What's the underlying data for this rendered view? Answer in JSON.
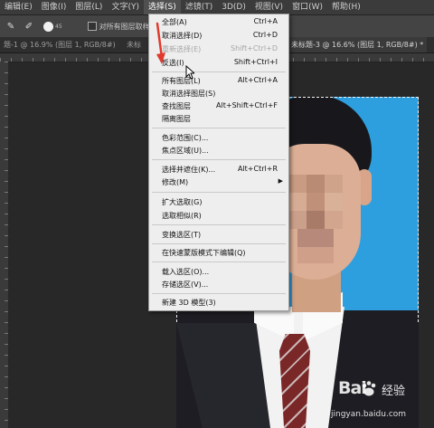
{
  "menubar": {
    "items": [
      {
        "label": "编辑(E)"
      },
      {
        "label": "图像(I)"
      },
      {
        "label": "图层(L)"
      },
      {
        "label": "文字(Y)"
      },
      {
        "label": "选择(S)",
        "active": true
      },
      {
        "label": "滤镜(T)"
      },
      {
        "label": "3D(D)"
      },
      {
        "label": "视图(V)"
      },
      {
        "label": "窗口(W)"
      },
      {
        "label": "帮助(H)"
      }
    ]
  },
  "options": {
    "brush_size": "45",
    "sample_all_layers_label": "对所有图层取样"
  },
  "tabs": {
    "left": "题-1 @ 16.9% (图层 1, RGB/8#)",
    "middle": "未标",
    "right": "未标题-3 @ 16.6% (图层 1, RGB/8#) *"
  },
  "select_menu": {
    "items": [
      {
        "label": "全部(A)",
        "shortcut": "Ctrl+A"
      },
      {
        "label": "取消选择(D)",
        "shortcut": "Ctrl+D"
      },
      {
        "label": "重新选择(E)",
        "shortcut": "Shift+Ctrl+D",
        "disabled": true
      },
      {
        "label": "反选(I)",
        "shortcut": "Shift+Ctrl+I"
      },
      {
        "label": "所有图层(L)",
        "shortcut": "Alt+Ctrl+A"
      },
      {
        "label": "取消选择图层(S)",
        "shortcut": ""
      },
      {
        "label": "查找图层",
        "shortcut": "Alt+Shift+Ctrl+F"
      },
      {
        "label": "隔离图层",
        "shortcut": ""
      },
      {
        "label": "色彩范围(C)...",
        "shortcut": ""
      },
      {
        "label": "焦点区域(U)...",
        "shortcut": ""
      },
      {
        "label": "选择并遮住(K)...",
        "shortcut": "Alt+Ctrl+R"
      },
      {
        "label": "修改(M)",
        "shortcut": ""
      },
      {
        "label": "扩大选取(G)",
        "shortcut": ""
      },
      {
        "label": "选取相似(R)",
        "shortcut": ""
      },
      {
        "label": "变换选区(T)",
        "shortcut": ""
      },
      {
        "label": "在快速蒙版模式下编辑(Q)",
        "shortcut": ""
      },
      {
        "label": "载入选区(O)...",
        "shortcut": ""
      },
      {
        "label": "存储选区(V)...",
        "shortcut": ""
      },
      {
        "label": "新建 3D 模型(3)",
        "shortcut": ""
      }
    ]
  },
  "watermark": {
    "brand": "Bai",
    "brand_cn": "经验",
    "url": "jingyan.baidu.com"
  },
  "colors": {
    "photo_background": "#2e9fde",
    "menu_background": "#eeeeee",
    "arrow": "#e03a2e"
  }
}
